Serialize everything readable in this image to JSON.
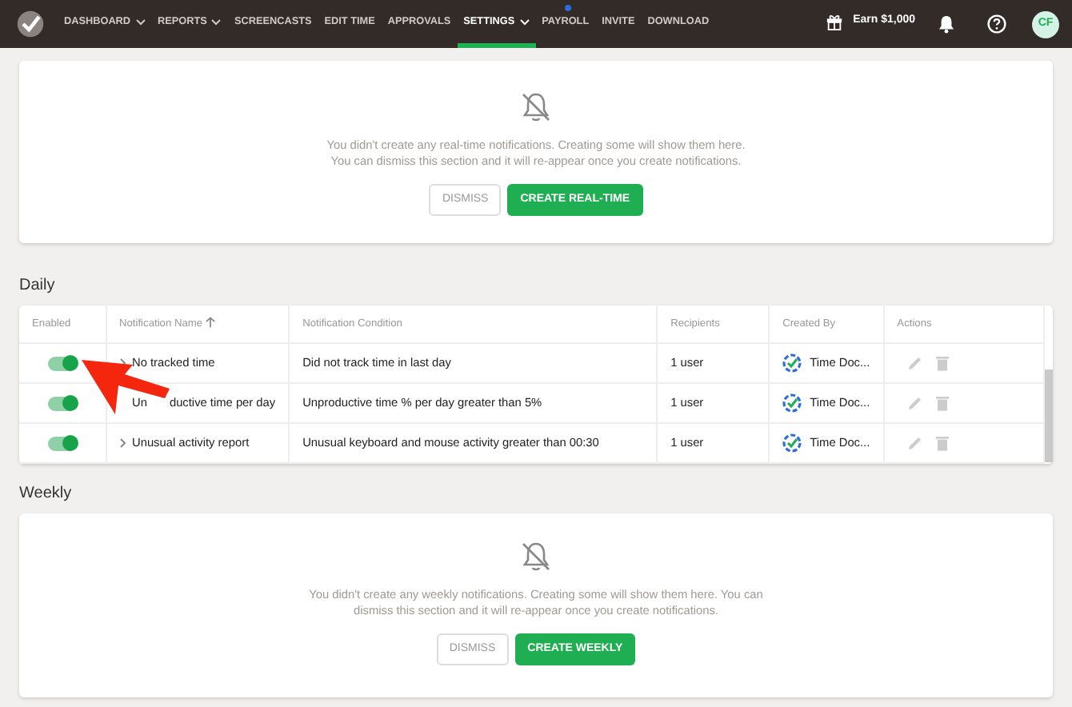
{
  "nav": {
    "items": [
      {
        "label": "DASHBOARD",
        "dropdown": true,
        "selected": false,
        "dot": false
      },
      {
        "label": "REPORTS",
        "dropdown": true,
        "selected": false,
        "dot": false
      },
      {
        "label": "SCREENCASTS",
        "dropdown": false,
        "selected": false,
        "dot": false
      },
      {
        "label": "EDIT TIME",
        "dropdown": false,
        "selected": false,
        "dot": false
      },
      {
        "label": "APPROVALS",
        "dropdown": false,
        "selected": false,
        "dot": false
      },
      {
        "label": "SETTINGS",
        "dropdown": true,
        "selected": true,
        "dot": false
      },
      {
        "label": "PAYROLL",
        "dropdown": false,
        "selected": false,
        "dot": true
      },
      {
        "label": "INVITE",
        "dropdown": false,
        "selected": false,
        "dot": false
      },
      {
        "label": "DOWNLOAD",
        "dropdown": false,
        "selected": false,
        "dot": false
      }
    ],
    "earn": "Earn $1,000",
    "avatar": "CF"
  },
  "realtime": {
    "lines": [
      "You didn't create any real-time notifications. Creating some will show them here.",
      "You can dismiss this section and it will re-appear once you create notifications."
    ],
    "dismiss": "DISMISS",
    "create": "CREATE REAL-TIME"
  },
  "daily": {
    "title": "Daily",
    "columns": [
      "Enabled",
      "Notification Name",
      "Notification Condition",
      "Recipients",
      "Created By",
      "Actions"
    ],
    "rows": [
      {
        "enabled": true,
        "chevron": true,
        "name": "No tracked time",
        "condition": "Did not track time in last day",
        "recipients": "1 user",
        "created_by": "Time Doc..."
      },
      {
        "enabled": true,
        "chevron": false,
        "name_lead": "Un",
        "name": "ductive time per day",
        "condition": "Unproductive time % per day greater than 5%",
        "recipients": "1 user",
        "created_by": "Time Doc..."
      },
      {
        "enabled": true,
        "chevron": true,
        "name": "Unusual activity report",
        "condition": "Unusual keyboard and mouse activity greater than 00:30",
        "recipients": "1 user",
        "created_by": "Time Doc..."
      }
    ]
  },
  "weekly": {
    "title": "Weekly",
    "lines": [
      "You didn't create any weekly notifications. Creating some will show them here. You can dismiss this section and it will re-appear once you create notifications."
    ],
    "dismiss": "DISMISS",
    "create": "CREATE WEEKLY"
  }
}
